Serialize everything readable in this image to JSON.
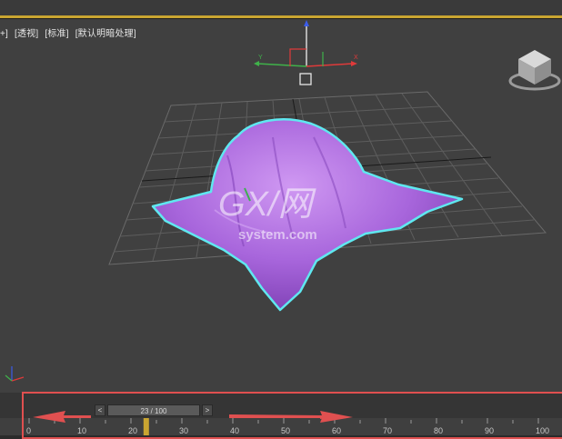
{
  "viewport": {
    "labels": [
      "+]",
      "[透视]",
      "[标准]",
      "[默认明暗处理]"
    ]
  },
  "timeline": {
    "frame_display": "23 / 100",
    "prev_label": "<",
    "next_label": ">",
    "ticks": [
      "0",
      "10",
      "20",
      "30",
      "40",
      "50",
      "60",
      "70",
      "80",
      "90",
      "100"
    ],
    "current_frame": 23,
    "total_frames": 100
  },
  "watermark": {
    "main": "GX/网",
    "sub": "system.com"
  },
  "colors": {
    "cloth": "#b06fe0",
    "selection_outline": "#5fe8f0",
    "highlight": "#e05050",
    "accent": "#c9a531"
  }
}
